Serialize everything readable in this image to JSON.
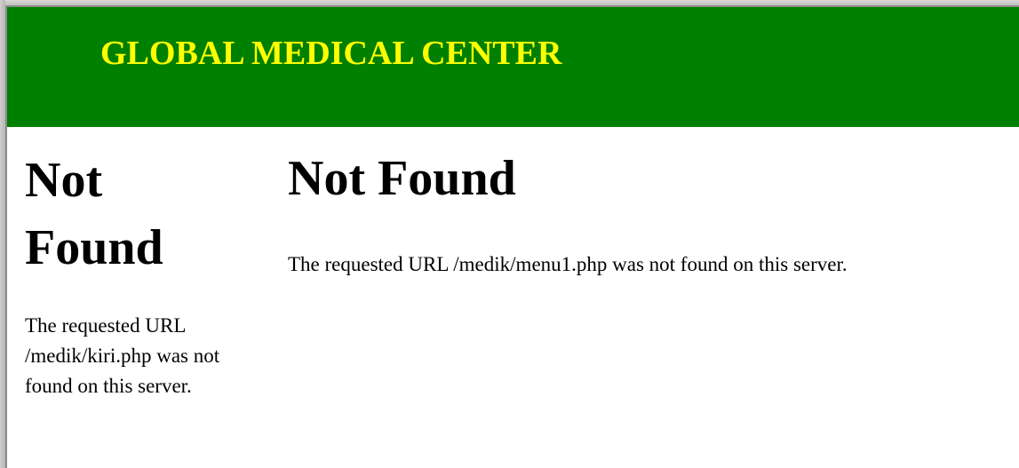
{
  "header": {
    "title": "GLOBAL MEDICAL CENTER",
    "background_color": "#008000",
    "title_color": "#FFFF00"
  },
  "left_frame": {
    "heading": "Not Found",
    "message": "The requested URL /medik/kiri.php was not found on this server."
  },
  "main_frame": {
    "heading": "Not Found",
    "message": "The requested URL /medik/menu1.php was not found on this server."
  }
}
